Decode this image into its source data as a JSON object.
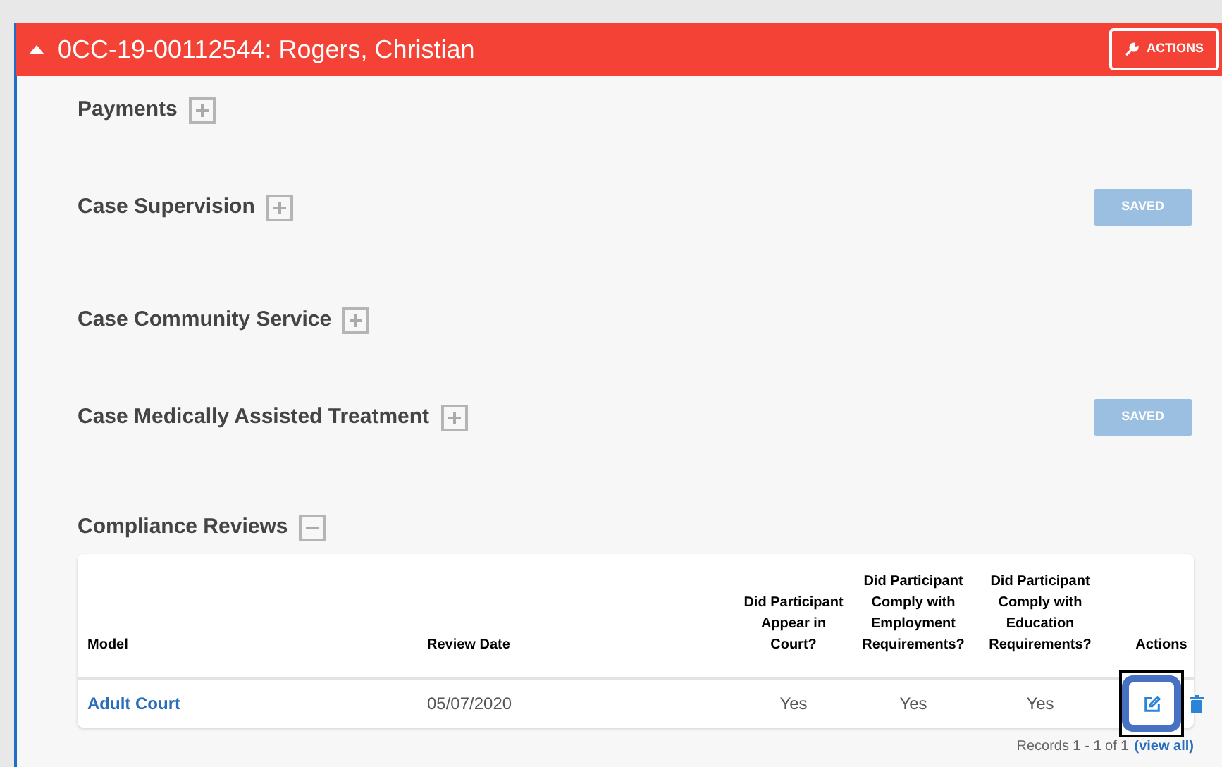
{
  "header": {
    "title": "0CC-19-00112544: Rogers, Christian",
    "expanded": true,
    "actions_button": "ACTIONS"
  },
  "sections": [
    {
      "title": "Payments",
      "expanded": false
    },
    {
      "title": "Case Supervision",
      "expanded": false,
      "badge": "SAVED"
    },
    {
      "title": "Case Community Service",
      "expanded": false
    },
    {
      "title": "Case Medically Assisted Treatment",
      "expanded": false,
      "badge": "SAVED"
    },
    {
      "title": "Compliance Reviews",
      "expanded": true,
      "table": {
        "columns": [
          "Model",
          "Review Date",
          "Did Participant Appear in Court?",
          "Did Participant Comply with Employment Requirements?",
          "Did Participant Comply with Education Requirements?",
          "Actions"
        ],
        "rows": [
          {
            "model": "Adult Court",
            "review_date": "05/07/2020",
            "appear": "Yes",
            "employment": "Yes",
            "education": "Yes",
            "edit_highlighted": true
          }
        ],
        "footer": "Records **1** - **1** of **1**",
        "view_all": "(view all)"
      }
    }
  ]
}
